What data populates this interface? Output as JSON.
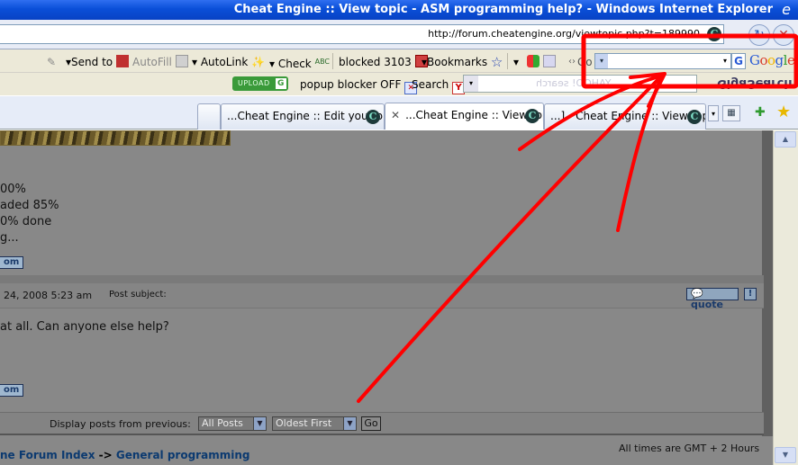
{
  "window": {
    "title": "Cheat Engine :: View topic - ASM programming help? - Windows Internet Explorer"
  },
  "address": {
    "url": "http://forum.cheatengine.org/viewtopic.php?t=189990"
  },
  "toolbar1": {
    "send_to": "Send to",
    "autofill": "AutoFill",
    "autolink": "AutoLink",
    "check": "Check",
    "blocked": "blocked 3103",
    "bookmarks": "Bookmarks",
    "go": "Go",
    "google": "Google"
  },
  "toolbar2": {
    "upload": "UPLOAD",
    "popup_blocker": "popup blocker OFF",
    "search": "Search",
    "yahoo_watermark": "YAHOO! search",
    "gigasearch": "GigaSearch"
  },
  "tabs": [
    {
      "label": "...Cheat Engine :: Edit your pro"
    },
    {
      "label": "...Cheat Engine :: View topi"
    },
    {
      "label": "...] - Cheat Engine :: View topic"
    }
  ],
  "post_top": {
    "lines": [
      "00%",
      "aded 85%",
      "0% done",
      "g..."
    ],
    "pm_button": "om"
  },
  "post2": {
    "date": "24, 2008 5:23 am",
    "subject_label": "Post subject:",
    "quote_button": "quote",
    "bang_button": "!",
    "body": "at all. Can anyone else help?",
    "pm_button": "om"
  },
  "filter": {
    "label": "Display posts from previous:",
    "range_value": "All Posts",
    "order_value": "Oldest First",
    "go_button": "Go"
  },
  "footer": {
    "times": "All times are GMT + 2 Hours",
    "crumb_forum": "ne Forum Index",
    "crumb_sep": "->",
    "crumb_section": "General programming"
  },
  "colors": {
    "annotation": "#ff0000",
    "title_bar": "#0a4fd8",
    "link": "#0c3a70"
  }
}
